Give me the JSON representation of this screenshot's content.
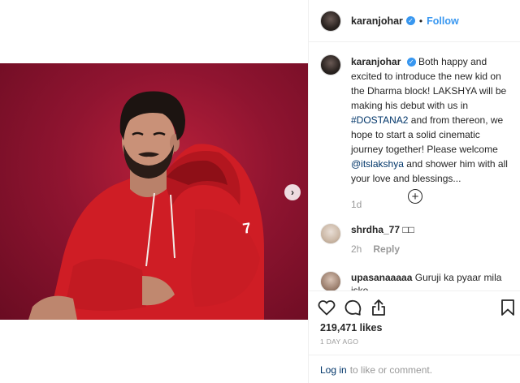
{
  "post": {
    "username": "karanjohar",
    "follow_label": "Follow",
    "separator": "•",
    "verified_mark": "✓",
    "next_icon": "chevron-right-icon",
    "caption_parts": {
      "text1": "Both happy and excited to introduce the new kid on the Dharma block! LAKSHYA will be making his debut with us in ",
      "hashtag": "#DOSTANA2",
      "text2": " and from thereon, we hope to start a solid cinematic journey together! Please welcome ",
      "mention": "@itslakshya",
      "text3": " and shower him with all your love and blessings..."
    },
    "caption_time": "1d",
    "load_more_icon": "plus-circle-icon"
  },
  "comments": [
    {
      "username": "shrdha_77",
      "text": "□□",
      "time": "2h",
      "reply_label": "Reply"
    },
    {
      "username": "upasanaaaaa",
      "text": "Guruji ka pyaar mila isko"
    }
  ],
  "actions": {
    "icons": [
      "heart-icon",
      "comment-icon",
      "share-icon",
      "bookmark-icon"
    ],
    "likes": "219,471 likes",
    "posted_ago": "1 DAY AGO",
    "login_link": "Log in",
    "login_text": "to like or comment."
  },
  "colors": {
    "link_blue": "#3897f0",
    "hashtag_navy": "#003569",
    "photo_background": "#9a1733",
    "hoodie_red": "#d41e26"
  }
}
